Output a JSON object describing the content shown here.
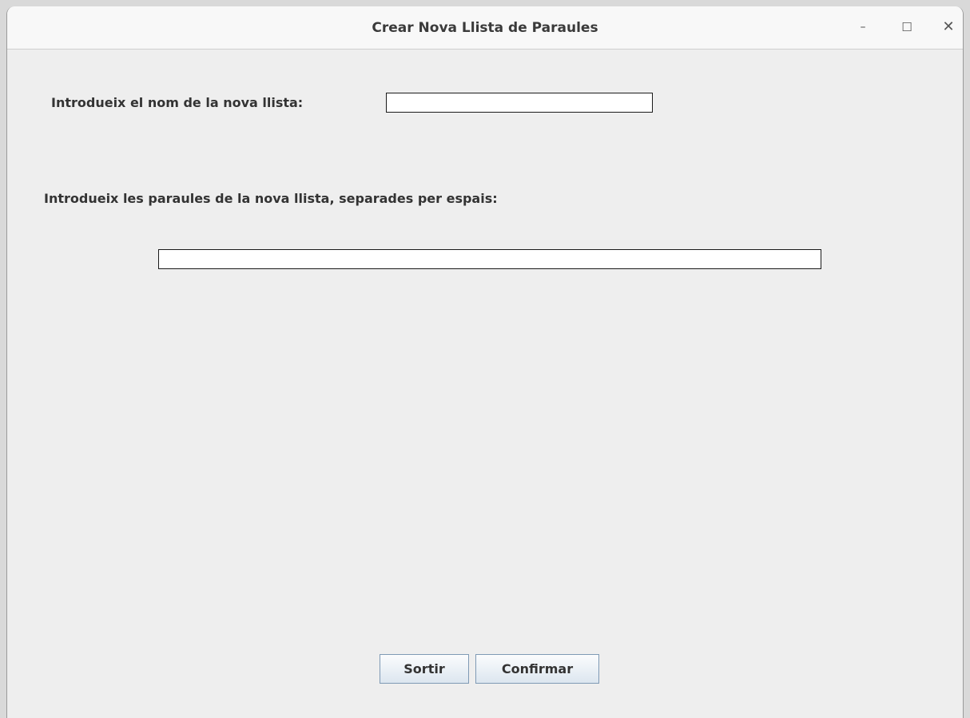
{
  "window": {
    "title": "Crear Nova Llista de Paraules",
    "controls": {
      "minimize": "–",
      "maximize": "☐",
      "close": "✕"
    }
  },
  "form": {
    "name_label": "Introdueix el nom de la nova llista:",
    "name_value": "",
    "words_label": "Introdueix les paraules de la nova llista, separades per espais:",
    "words_value": ""
  },
  "buttons": {
    "exit_label": "Sortir",
    "confirm_label": "Confirmar"
  }
}
